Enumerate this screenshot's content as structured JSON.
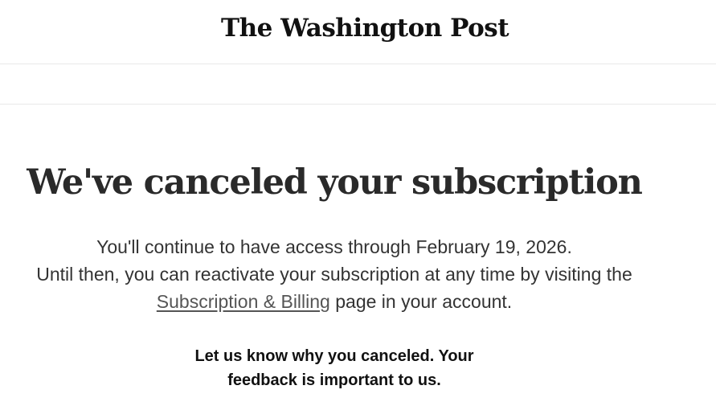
{
  "header": {
    "logo_text": "The Washington Post"
  },
  "main": {
    "headline": "We've canceled your subscription",
    "access_line": "You'll continue to have access through February 19, 2026.",
    "reactivate_line": "Until then, you can reactivate your subscription at any time by visiting the",
    "billing_link": "Subscription & Billing",
    "billing_suffix": " page in your account.",
    "feedback_line1": "Let us know why you canceled. Your",
    "feedback_line2": "feedback is important to us."
  }
}
